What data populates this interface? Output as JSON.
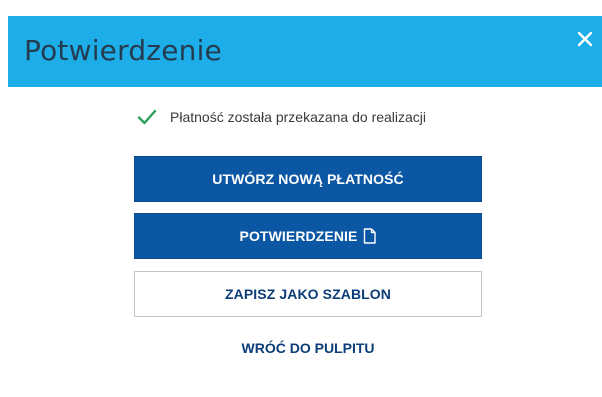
{
  "dialog": {
    "title": "Potwierdzenie",
    "close_icon": "close-icon"
  },
  "status": {
    "icon": "checkmark-icon",
    "text": "Płatność została przekazana do realizacji"
  },
  "actions": {
    "new_payment_label": "UTWÓRZ NOWĄ PŁATNOŚĆ",
    "confirmation_label": "POTWIERDZENIE",
    "confirmation_icon": "document-icon",
    "save_template_label": "ZAPISZ JAKO SZABLON",
    "back_to_dashboard_label": "WRÓĆ DO PULPITU"
  },
  "colors": {
    "header_bg": "#1daee9",
    "primary_button": "#0c57a4",
    "success": "#2aa25f",
    "link": "#0c3d78"
  }
}
